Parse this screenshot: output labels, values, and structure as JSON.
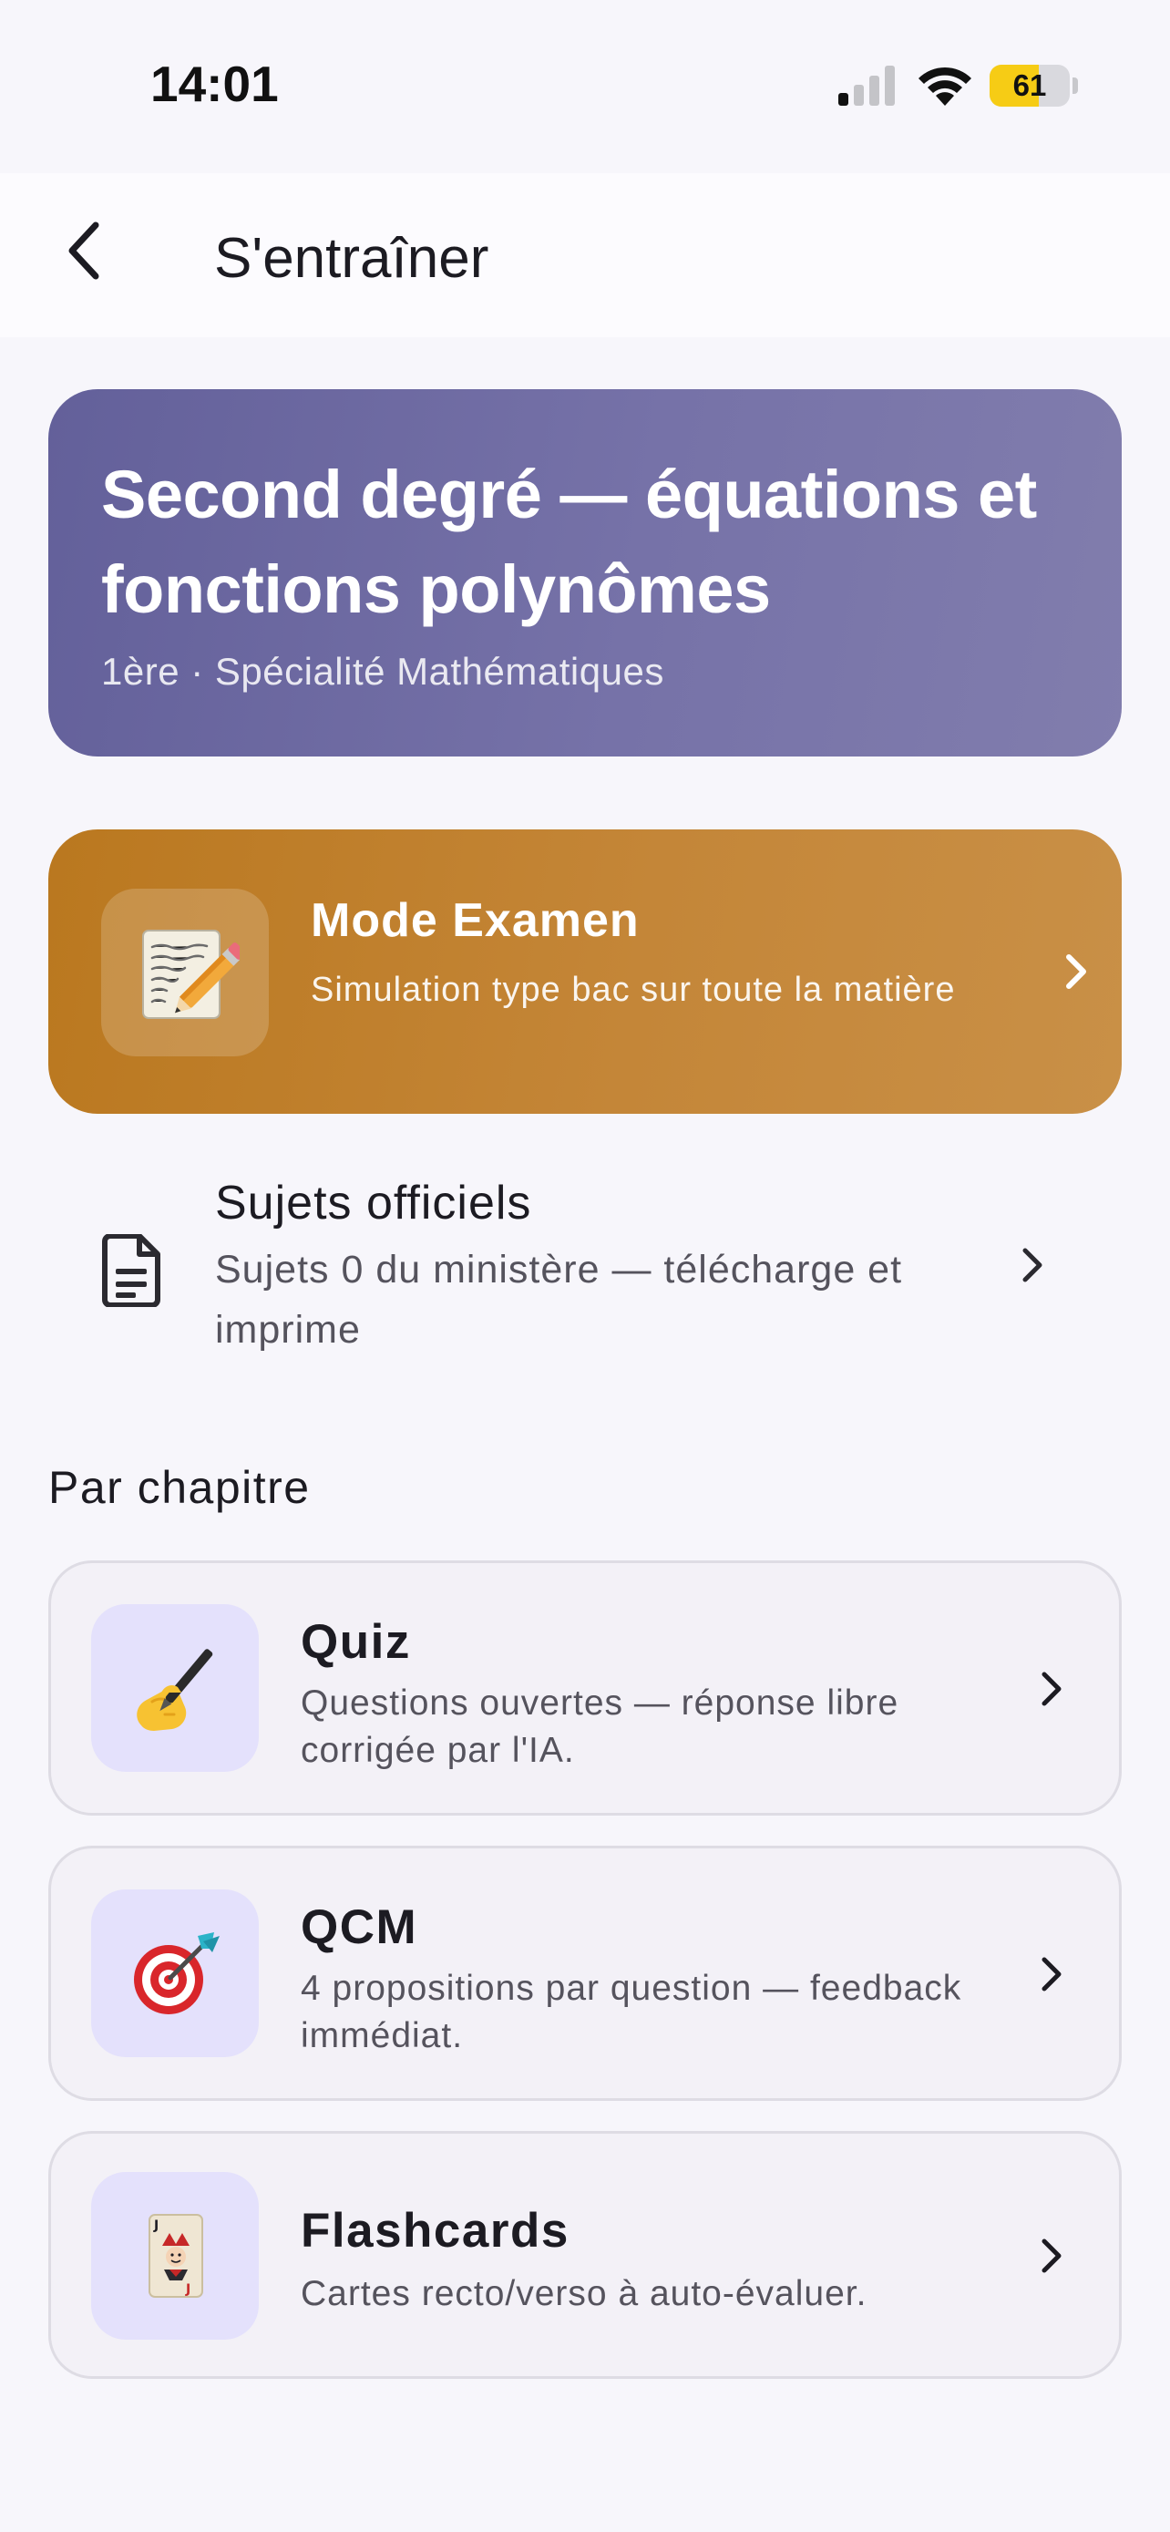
{
  "status_bar": {
    "time": "14:01",
    "battery_percent": 61,
    "battery_label": "61",
    "signal_bars_active": 1,
    "signal_bars_total": 4
  },
  "nav": {
    "title": "S'entraîner",
    "back_icon": "chevron-left-icon"
  },
  "hero": {
    "title": "Second degré — équations et fonctions polynômes",
    "subtitle": "1ère · Spécialité Mathématiques"
  },
  "exam_card": {
    "icon": "memo-pencil-emoji",
    "icon_glyph": "📝",
    "title": "Mode Examen",
    "description": "Simulation type bac sur toute la matière"
  },
  "official_subjects": {
    "icon": "document-icon",
    "title": "Sujets officiels",
    "description": "Sujets 0 du ministère — télécharge et imprime"
  },
  "section": {
    "title": "Par chapitre"
  },
  "modes": [
    {
      "icon": "writing-hand-emoji",
      "icon_glyph": "✍️",
      "title": "Quiz",
      "description": "Questions ouvertes — réponse libre corrigée par l'IA."
    },
    {
      "icon": "target-dart-emoji",
      "icon_glyph": "🎯",
      "title": "QCM",
      "description": "4 propositions par question — feedback immédiat."
    },
    {
      "icon": "joker-card-emoji",
      "icon_glyph": "🃏",
      "title": "Flashcards",
      "description": "Cartes recto/verso à auto-évaluer."
    }
  ],
  "colors": {
    "hero_gradient_start": "#63609a",
    "hero_gradient_end": "#817dad",
    "exam_gradient_start": "#ba781f",
    "exam_gradient_end": "#c99047",
    "mode_icon_bg": "#e4e1fc",
    "battery_fill": "#f6cc15"
  }
}
